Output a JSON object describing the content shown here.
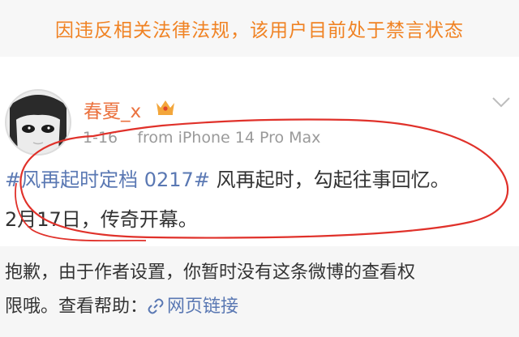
{
  "banner": {
    "text": "因违反相关法律法规，该用户目前处于禁言状态"
  },
  "post": {
    "username": "春夏_x",
    "time": "1-16",
    "source": "from iPhone 14 Pro Max",
    "topic": "#风再起时定档 0217#",
    "text_line1": " 风再起时，勾起往事回忆。",
    "text_line2": "2月17日，传奇开幕。",
    "icons": {
      "avatar": "avatar",
      "badge": "crown-icon",
      "menu": "chevron-down-icon"
    }
  },
  "notice": {
    "line1": "抱歉，由于作者设置，你暂时没有这条微博的查看权",
    "line2_prefix": "限哦。查看帮助：",
    "link_label": "网页链接",
    "link_icon": "link-icon"
  },
  "colors": {
    "banner_text": "#f08324",
    "username": "#eb7340",
    "link": "#5a78b3",
    "annotation": "#e0312a"
  }
}
